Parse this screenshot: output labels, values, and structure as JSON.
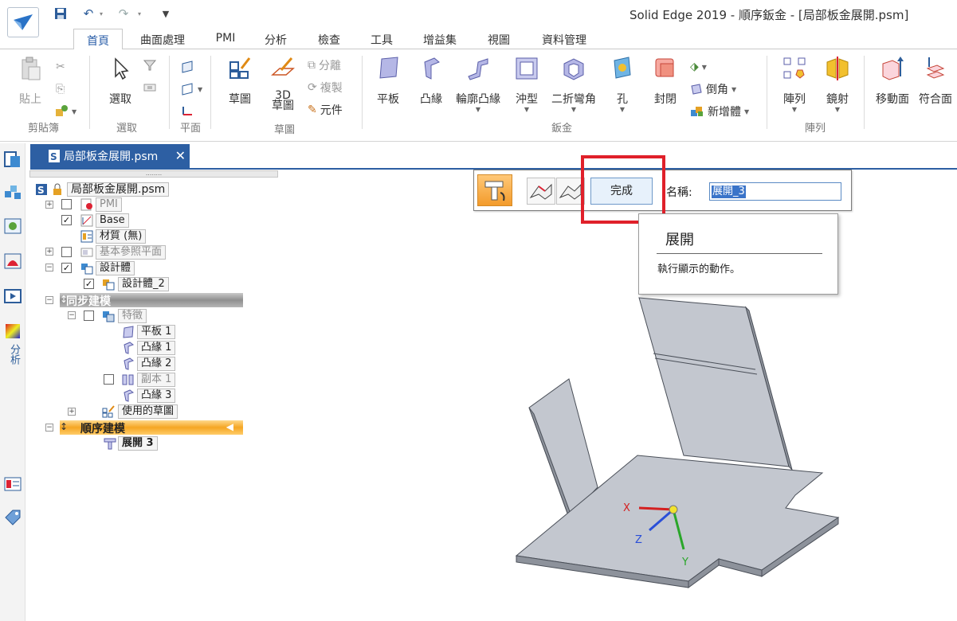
{
  "window": {
    "title": "Solid Edge 2019 - 順序鈑金 - [局部板金展開.psm]"
  },
  "ribbon_tabs": [
    "首頁",
    "曲面處理",
    "PMI",
    "分析",
    "檢查",
    "工具",
    "增益集",
    "視圖",
    "資料管理"
  ],
  "ribbon": {
    "clipboard": {
      "paste": "貼上",
      "group": "剪貼簿"
    },
    "select": {
      "select": "選取",
      "group": "選取"
    },
    "planes": {
      "group": "平面"
    },
    "sketch": {
      "sketch": "草圖",
      "sketch3d_a": "3D",
      "sketch3d_b": "草圖",
      "split": "分離",
      "copy": "複製",
      "component": "元件",
      "group": "草圖"
    },
    "sheetmetal": {
      "tab": "平板",
      "flange": "凸緣",
      "contour_flange": "輪廓凸緣",
      "dimple": "沖型",
      "bend": "二折彎角",
      "hole": "孔",
      "close": "封閉",
      "chamfer": "倒角",
      "new_body": "新增體",
      "group": "鈑金"
    },
    "pattern": {
      "pattern": "陣列",
      "mirror": "鏡射",
      "group": "陣列"
    },
    "faces": {
      "move": "移動面",
      "coincident": "符合面"
    }
  },
  "document_tab": {
    "label": "局部板金展開.psm",
    "close": "✕"
  },
  "tree": {
    "root": "局部板金展開.psm",
    "pmi": "PMI",
    "base": "Base",
    "material": "材質 (無)",
    "ref_planes": "基本參照平面",
    "design_body": "設計體",
    "design_body_2": "設計體_2",
    "sync_modeling": "同步建模",
    "features": "特徵",
    "tab1": "平板 1",
    "flange1": "凸緣 1",
    "flange2": "凸緣 2",
    "copy1": "副本 1",
    "flange3": "凸緣 3",
    "used_sketches": "使用的草圖",
    "ordered_modeling": "順序建模",
    "unfold3": "展開 3"
  },
  "command_bar": {
    "finish": "完成",
    "name_label": "名稱:",
    "name_value": "展開_3"
  },
  "tooltip": {
    "title": "展開",
    "description": "執行顯示的動作。"
  },
  "left_toolbar": {
    "analysis": "分析"
  },
  "axes": {
    "x": "X",
    "y": "Y",
    "z": "Z"
  },
  "colors": {
    "accent": "#2d5fa3",
    "highlight": "#e0202a",
    "active_feature": "#f5a623"
  }
}
